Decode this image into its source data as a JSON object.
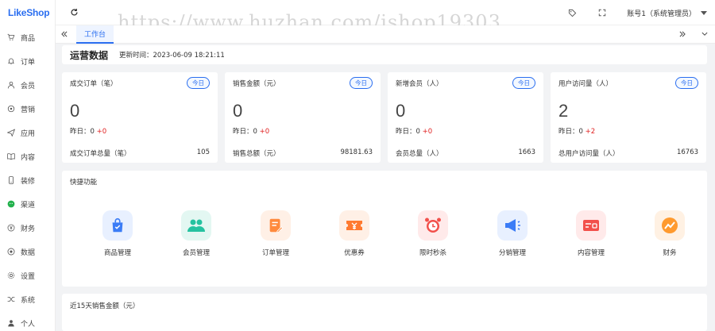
{
  "brand": {
    "logo_text": "LikeShop",
    "color": "#2a6ef0"
  },
  "sidebar": {
    "items": [
      {
        "label": "商品",
        "icon": "cart-icon"
      },
      {
        "label": "订单",
        "icon": "bell-icon"
      },
      {
        "label": "会员",
        "icon": "user-icon"
      },
      {
        "label": "营销",
        "icon": "target-icon"
      },
      {
        "label": "应用",
        "icon": "send-icon"
      },
      {
        "label": "内容",
        "icon": "book-icon"
      },
      {
        "label": "装修",
        "icon": "phone-icon"
      },
      {
        "label": "渠道",
        "icon": "wechat-icon"
      },
      {
        "label": "财务",
        "icon": "yen-icon"
      },
      {
        "label": "数据",
        "icon": "data-icon"
      },
      {
        "label": "设置",
        "icon": "gear-icon"
      },
      {
        "label": "系统",
        "icon": "shuffle-icon"
      },
      {
        "label": "个人",
        "icon": "person-icon"
      }
    ]
  },
  "header": {
    "watermark": "https://www.huzhan.com/ishop19303",
    "account_label": "账号1（系统管理员）"
  },
  "tabbar": {
    "active_tab": "工作台"
  },
  "overview": {
    "title": "运营数据",
    "update_time": "更新时间：2023-06-09 18:21:11"
  },
  "stats": [
    {
      "label": "成交订单（笔）",
      "badge": "今日",
      "value": "0",
      "yest_label": "昨日：0",
      "yest_delta": "+0",
      "total_label": "成交订单总量（笔）",
      "total_value": "105"
    },
    {
      "label": "销售金额（元）",
      "badge": "今日",
      "value": "0",
      "yest_label": "昨日：0",
      "yest_delta": "+0",
      "total_label": "销售总额（元）",
      "total_value": "98181.63"
    },
    {
      "label": "新增会员（人）",
      "badge": "今日",
      "value": "0",
      "yest_label": "昨日：0",
      "yest_delta": "+0",
      "total_label": "会员总量（人）",
      "total_value": "1663"
    },
    {
      "label": "用户访问量（人）",
      "badge": "今日",
      "value": "2",
      "yest_label": "昨日：0",
      "yest_delta": "+2",
      "total_label": "总用户访问量（人）",
      "total_value": "16763"
    }
  ],
  "quick": {
    "title": "快捷功能",
    "items": [
      {
        "label": "商品管理",
        "icon": "shopping-bag-icon",
        "bg": "#e8f0ff",
        "fg": "#3b7cf6"
      },
      {
        "label": "会员管理",
        "icon": "members-icon",
        "bg": "#e3f7f2",
        "fg": "#25c2a0"
      },
      {
        "label": "订单管理",
        "icon": "order-doc-icon",
        "bg": "#fff0e6",
        "fg": "#ff8a3d"
      },
      {
        "label": "优惠券",
        "icon": "coupon-icon",
        "bg": "#fff0e6",
        "fg": "#ff7a30"
      },
      {
        "label": "限时秒杀",
        "icon": "alarm-clock-icon",
        "bg": "#ffeaea",
        "fg": "#f2504b"
      },
      {
        "label": "分销管理",
        "icon": "megaphone-icon",
        "bg": "#e8f0ff",
        "fg": "#3b7cf6"
      },
      {
        "label": "内容管理",
        "icon": "content-card-icon",
        "bg": "#ffeaea",
        "fg": "#f2504b"
      },
      {
        "label": "财务",
        "icon": "finance-chart-icon",
        "bg": "#fff1e3",
        "fg": "#ff9a2e"
      }
    ]
  },
  "sales": {
    "title": "近15天销售金额（元）"
  }
}
